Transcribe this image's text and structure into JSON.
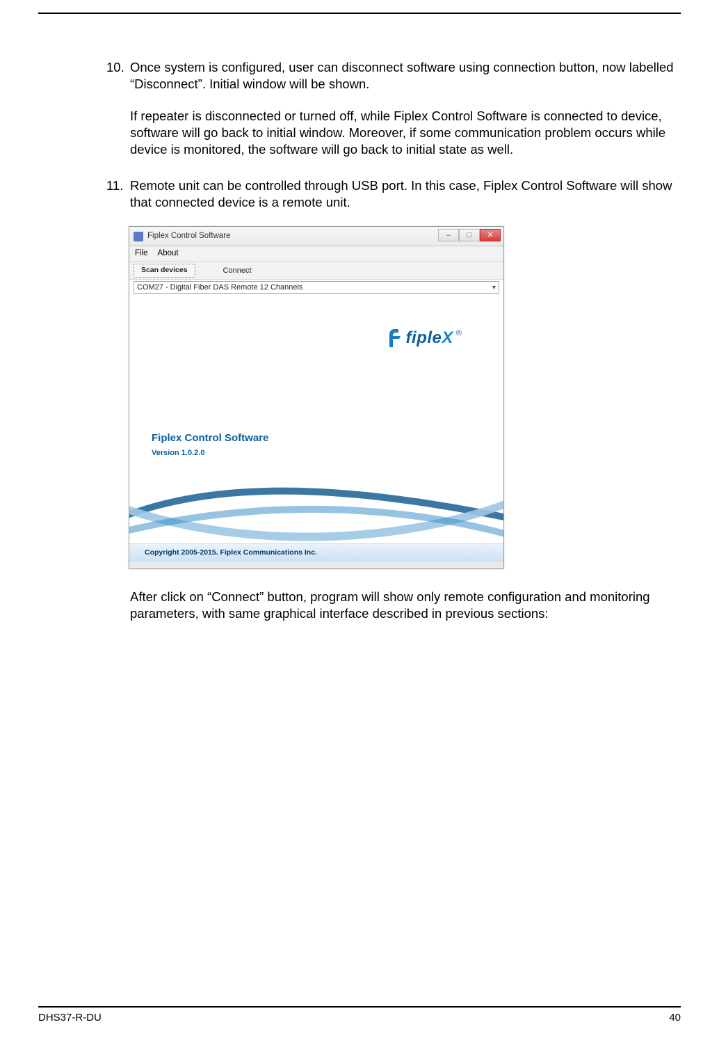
{
  "items": {
    "num10": "10.",
    "para10a": "Once system is configured, user can disconnect software using connection button, now labelled “Disconnect”. Initial window will be shown.",
    "para10b": "If repeater is disconnected or turned off, while Fiplex Control Software is connected to device, software will go back to initial window. Moreover, if some communication problem occurs while device is monitored, the software will go back to initial state as well.",
    "num11": "11.",
    "para11a": "Remote unit can be controlled through USB port. In this case, Fiplex Control Software will show that connected device is a remote unit.",
    "para11b": "After click on “Connect” button, program will show only remote configuration and monitoring parameters, with same graphical interface described in previous sections:"
  },
  "app": {
    "title": "Fiplex Control Software",
    "menu": {
      "file": "File",
      "about": "About"
    },
    "toolbar": {
      "scan": "Scan devices",
      "connect": "Connect"
    },
    "combo": "COM27 - Digital Fiber DAS Remote 12 Channels",
    "logo_text": "fiple",
    "logo_suffix": "X",
    "reg": "®",
    "product_title": "Fiplex Control Software",
    "product_version": "Version 1.0.2.0",
    "copyright": "Copyright 2005-2015. Fiplex Communications Inc.",
    "win": {
      "min": "–",
      "max": "□",
      "close": "✕"
    }
  },
  "footer": {
    "left": "DHS37-R-DU",
    "right": "40"
  }
}
